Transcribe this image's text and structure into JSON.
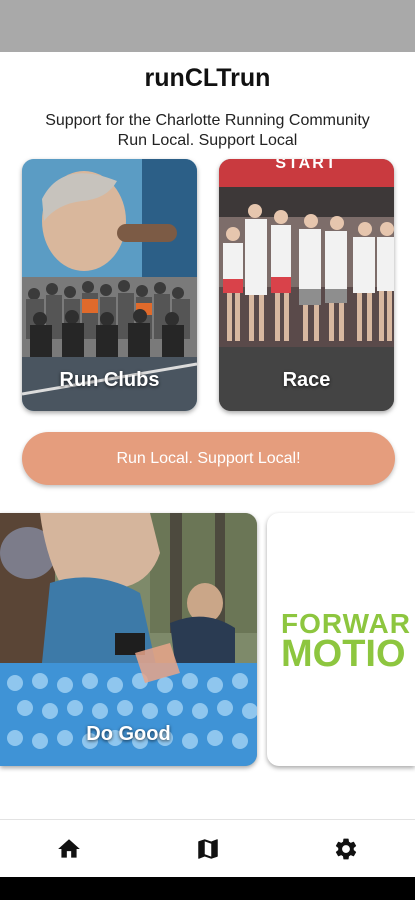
{
  "app": {
    "title": "runCLTrun",
    "tagline_1": "Support for the Charlotte Running Community",
    "tagline_2": "Run Local. Support Local"
  },
  "cards": {
    "run_clubs": {
      "label": "Run Clubs"
    },
    "race": {
      "label": "Race",
      "banner": "START"
    },
    "do_good": {
      "label": "Do Good"
    },
    "forward_motion": {
      "logo_line_1": "FORWAR",
      "logo_line_2": "MOTIO"
    }
  },
  "cta": {
    "label": "Run Local. Support Local!"
  },
  "nav": {
    "home_icon": "home-icon",
    "map_icon": "map-icon",
    "settings_icon": "gear-icon"
  },
  "colors": {
    "cta": "#e59d7d",
    "logo_green": "#8dc63f",
    "status_bar": "#a9a9a9"
  }
}
